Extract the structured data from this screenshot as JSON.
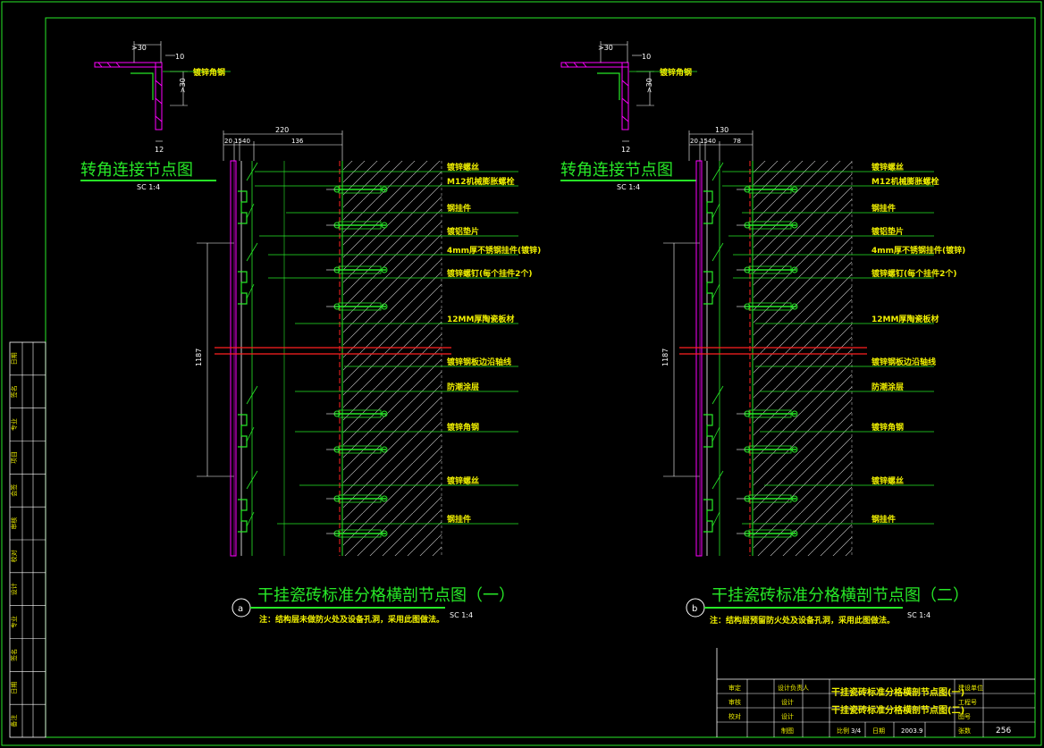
{
  "colors": {
    "frame": "#27e827",
    "text": "#e8e800",
    "wall": "#ff00ff",
    "redline": "#ff2020",
    "white": "#ffffff"
  },
  "left": {
    "corner_title": "转角连接节点图",
    "corner_scale": "SC  1:4",
    "corner_label": "镀锌角钢",
    "corner_dims": {
      "top": ">30",
      "right": "10",
      "side": ">30",
      "bottom": "12"
    },
    "dims_top": {
      "total": "220",
      "a": "20",
      "b": "15",
      "c": "40",
      "d": "136"
    },
    "height_dim": "1187",
    "labels": [
      "镀锌螺丝",
      "M12机械膨胀螺栓",
      "钢挂件",
      "镀铝垫片",
      "4mm厚不锈钢挂件(镀锌)",
      "镀锌螺钉(每个挂件2个)",
      "12MM厚陶瓷板材",
      "镀锌钢板边沿轴线",
      "防潮涂层",
      "镀锌角钢",
      "镀锌螺丝",
      "钢挂件"
    ],
    "main_title": "干挂瓷砖标准分格横剖节点图（一）",
    "marker": "a",
    "note": "注：结构层未做防火处及设备孔洞，采用此图做法。",
    "scale": "SC  1:4"
  },
  "right": {
    "corner_title": "转角连接节点图",
    "corner_scale": "SC  1:4",
    "corner_label": "镀锌角钢",
    "corner_dims": {
      "top": ">30",
      "right": "10",
      "side": ">30",
      "bottom": "12"
    },
    "dims_top": {
      "total": "130",
      "a": "20",
      "b": "15",
      "c": "40",
      "d": "78"
    },
    "height_dim": "1187",
    "labels": [
      "镀锌螺丝",
      "M12机械膨胀螺栓",
      "钢挂件",
      "镀铝垫片",
      "4mm厚不锈钢挂件(镀锌)",
      "镀锌螺钉(每个挂件2个)",
      "12MM厚陶瓷板材",
      "镀锌钢板边沿轴线",
      "防潮涂层",
      "镀锌角钢",
      "镀锌螺丝",
      "钢挂件"
    ],
    "main_title": "干挂瓷砖标准分格横剖节点图（二）",
    "marker": "b",
    "note": "注：结构层预留防火处及设备孔洞，采用此图做法。",
    "scale": "SC  1:4"
  },
  "side_strip": [
    "日期",
    "签名",
    "专业",
    "项目",
    "会签",
    "审核",
    "校对",
    "设计",
    "专业",
    "签名",
    "日期",
    "备注"
  ],
  "title_block": {
    "rows": [
      [
        "审定",
        "设计负责人"
      ],
      [
        "审核",
        "设计"
      ],
      [
        "校对",
        "设计"
      ],
      [
        "",
        "制图"
      ]
    ],
    "drawing_name_1": "干挂瓷砖标准分格横剖节点图(一)",
    "drawing_name_2": "干挂瓷砖标准分格横剖节点图(二)",
    "right_labels": [
      "建设单位",
      "工程号",
      "图号"
    ],
    "scale_label": "比例",
    "scale_value": "3/4",
    "date_label": "日期",
    "date_value": "2003.9",
    "sheet_label": "张数",
    "sheet_number": "256"
  }
}
